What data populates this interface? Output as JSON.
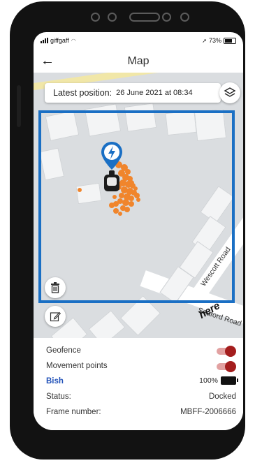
{
  "status_bar": {
    "carrier": "giffgaff",
    "battery": "73%"
  },
  "header": {
    "title": "Map"
  },
  "map": {
    "info_label": "Latest position:",
    "info_value": "26 June 2021 at 08:34",
    "road_labels": [
      "Wescott Road",
      "Seaford Road"
    ],
    "brand_logo": "here",
    "geofence_color": "#1a6fc4",
    "pin_color": "#1a6fc4",
    "points_color": "#f0852c",
    "icons": [
      "layers-icon",
      "lightning-icon",
      "trash-icon",
      "edit-icon"
    ]
  },
  "panel": {
    "geofence_label": "Geofence",
    "geofence_on": true,
    "movement_label": "Movement points",
    "movement_on": true,
    "bike_name": "Bish",
    "battery_percent": "100%",
    "battery_level": 1.0,
    "status_label": "Status:",
    "status_value": "Docked",
    "frame_label": "Frame number:",
    "frame_value": "MBFF-2006666",
    "toggle_color": "#a41d1d"
  }
}
